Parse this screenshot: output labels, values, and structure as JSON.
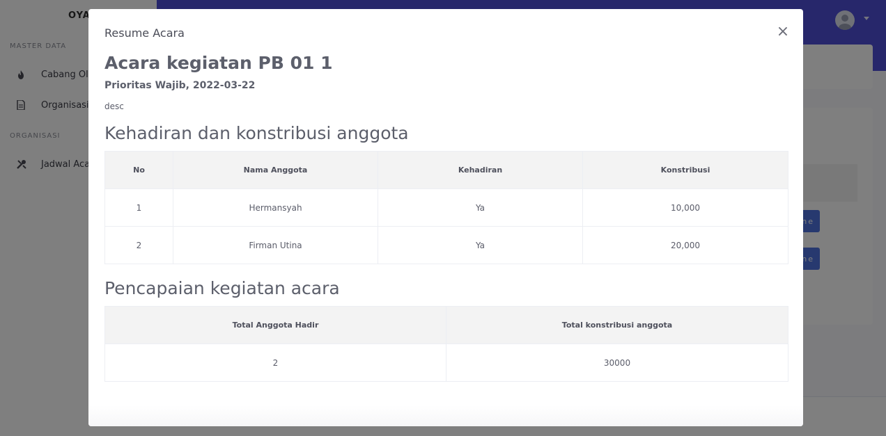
{
  "app": {
    "brand": "OYA"
  },
  "sidebar": {
    "section_master": "MASTER DATA",
    "section_org": "ORGANISASI",
    "items": [
      {
        "label": "Cabang Ola",
        "icon": "fire-icon"
      },
      {
        "label": "Organisasi",
        "icon": "document-icon"
      },
      {
        "label": "Jadwal Aca",
        "icon": "tools-icon"
      }
    ]
  },
  "background": {
    "button_label": "ne"
  },
  "modal": {
    "title": "Resume Acara",
    "close_symbol": "×",
    "event_title": "Acara kegiatan PB 01 1",
    "event_subtitle": "Prioritas Wajib, 2022-03-22",
    "event_description": "desc",
    "attendance_section_title": "Kehadiran dan konstribusi anggota",
    "attendance_table": {
      "headers": [
        "No",
        "Nama Anggota",
        "Kehadiran",
        "Konstribusi"
      ],
      "rows": [
        [
          "1",
          "Hermansyah",
          "Ya",
          "10,000"
        ],
        [
          "2",
          "Firman Utina",
          "Ya",
          "20,000"
        ]
      ]
    },
    "achievement_section_title": "Pencapaian kegiatan acara",
    "achievement_table": {
      "headers": [
        "Total Anggota Hadir",
        "Total konstribusi anggota"
      ],
      "rows": [
        [
          "2",
          "30000"
        ]
      ]
    }
  }
}
